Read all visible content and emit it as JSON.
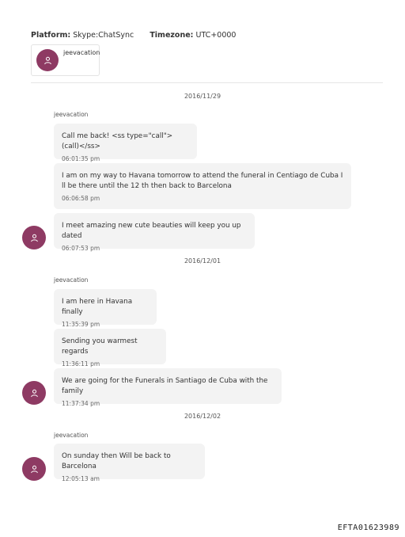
{
  "header": {
    "platform_label": "Platform:",
    "platform_value": "Skype:ChatSync",
    "timezone_label": "Timezone:",
    "timezone_value": "UTC+0000"
  },
  "participant": {
    "name": "jeevacation",
    "avatar_icon": "user-icon"
  },
  "colors": {
    "avatar": "#8e3a63",
    "bubble": "#f3f3f3"
  },
  "groups": [
    {
      "date": "2016/11/29",
      "sender": "jeevacation",
      "messages": [
        {
          "text": "Call me back! <ss type=\"call\">(call)</ss>",
          "time": "06:01:35 pm"
        },
        {
          "text": "I am on my way to Havana  tomorrow to attend the funeral in   Centiago  de Cuba I ll be there until the 12 th then back to Barcelona",
          "time": "06:06:58 pm"
        },
        {
          "text": "I meet amazing new cute beauties will keep you up dated",
          "time": "06:07:53 pm"
        }
      ]
    },
    {
      "date": "2016/12/01",
      "sender": "jeevacation",
      "messages": [
        {
          "text": "I am here  in Havana finally",
          "time": "11:35:39 pm"
        },
        {
          "text": "Sending you warmest regards",
          "time": "11:36:11 pm"
        },
        {
          "text": "We are going for the Funerals in Santiago de Cuba with the family",
          "time": "11:37:34 pm"
        }
      ]
    },
    {
      "date": "2016/12/02",
      "sender": "jeevacation",
      "messages": [
        {
          "text": "On sunday then Will be back to Barcelona",
          "time": "12:05:13 am"
        }
      ]
    }
  ],
  "footer": {
    "doc_id": "EFTA01623989"
  }
}
